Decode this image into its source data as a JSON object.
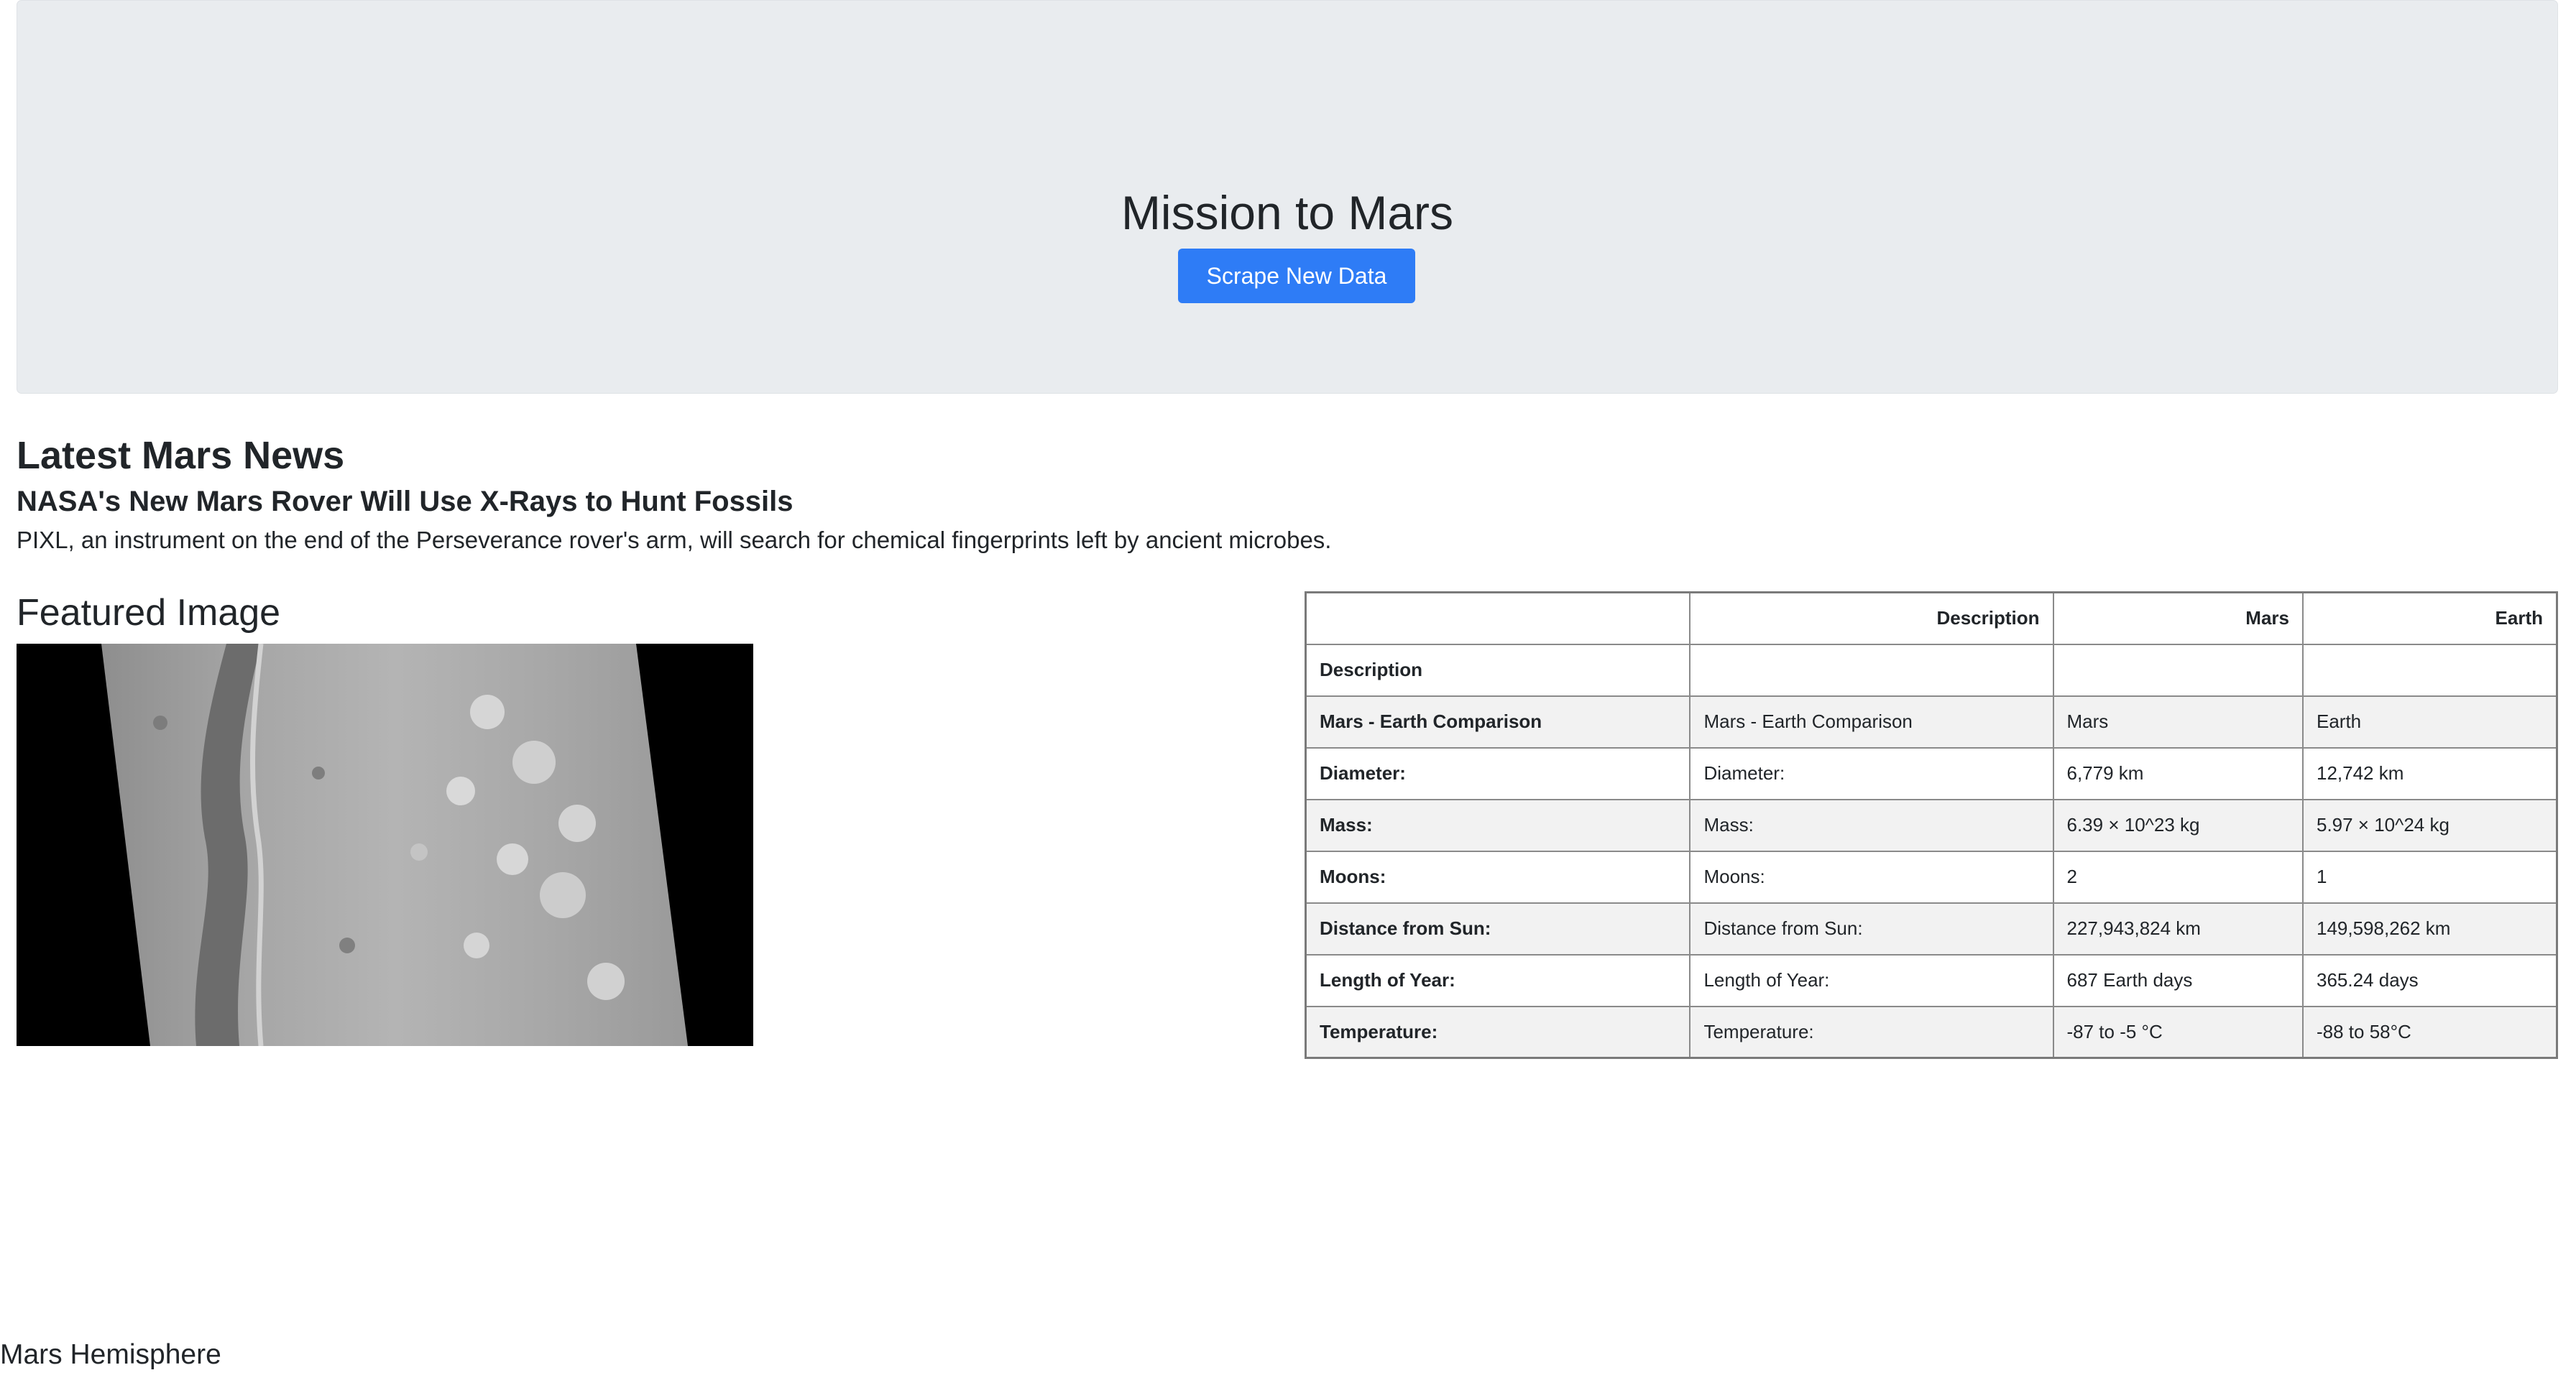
{
  "header": {
    "title": "Mission to Mars",
    "scrape_button_label": "Scrape New Data"
  },
  "news": {
    "heading": "Latest Mars News",
    "title": "NASA's New Mars Rover Will Use X-Rays to Hunt Fossils",
    "teaser": "PIXL, an instrument on the end of the Perseverance rover's arm, will search for chemical fingerprints left by ancient microbes."
  },
  "featured": {
    "heading": "Featured Image"
  },
  "facts_table": {
    "headers": [
      "",
      "Description",
      "Mars",
      "Earth"
    ],
    "rows": [
      [
        "Description",
        "",
        "",
        ""
      ],
      [
        "Mars - Earth Comparison",
        "Mars - Earth Comparison",
        "Mars",
        "Earth"
      ],
      [
        "Diameter:",
        "Diameter:",
        "6,779 km",
        "12,742 km"
      ],
      [
        "Mass:",
        "Mass:",
        "6.39 × 10^23 kg",
        "5.97 × 10^24 kg"
      ],
      [
        "Moons:",
        "Moons:",
        "2",
        "1"
      ],
      [
        "Distance from Sun:",
        "Distance from Sun:",
        "227,943,824 km",
        "149,598,262 km"
      ],
      [
        "Length of Year:",
        "Length of Year:",
        "687 Earth days",
        "365.24 days"
      ],
      [
        "Temperature:",
        "Temperature:",
        "-87 to -5 °C",
        "-88 to 58°C"
      ]
    ]
  },
  "hemispheres": {
    "heading": "Mars Hemisphere"
  },
  "colors": {
    "jumbotron_bg": "#e9ecef",
    "button_bg": "#2e7cf6",
    "table_stripe": "#f2f2f2"
  }
}
